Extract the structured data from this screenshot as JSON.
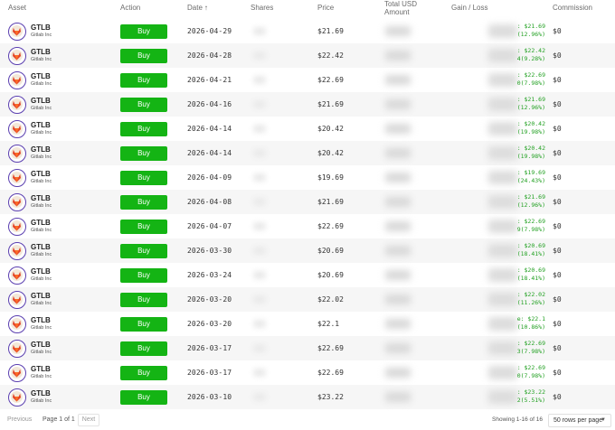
{
  "columns": {
    "asset": "Asset",
    "action": "Action",
    "date": "Date",
    "date_sort_icon": "arrow-up-icon",
    "shares": "Shares",
    "price": "Price",
    "total_usd_line1": "Total USD",
    "total_usd_line2": "Amount",
    "gain_loss": "Gain / Loss",
    "commission": "Commission"
  },
  "rows": [
    {
      "ticker": "GTLB",
      "company": "Gitlab Inc",
      "action": "Buy",
      "date": "2026-04-29",
      "price": "$21.69",
      "gain_line1": ": $21.69",
      "gain_line2": "(12.96%)",
      "commission": "$0"
    },
    {
      "ticker": "GTLB",
      "company": "Gitlab Inc",
      "action": "Buy",
      "date": "2026-04-28",
      "price": "$22.42",
      "gain_line1": ": $22.42",
      "gain_line2": "4(9.28%)",
      "commission": "$0"
    },
    {
      "ticker": "GTLB",
      "company": "Gitlab Inc",
      "action": "Buy",
      "date": "2026-04-21",
      "price": "$22.69",
      "gain_line1": ": $22.69",
      "gain_line2": "0(7.98%)",
      "commission": "$0"
    },
    {
      "ticker": "GTLB",
      "company": "Gitlab Inc",
      "action": "Buy",
      "date": "2026-04-16",
      "price": "$21.69",
      "gain_line1": ": $21.69",
      "gain_line2": "(12.96%)",
      "commission": "$0"
    },
    {
      "ticker": "GTLB",
      "company": "Gitlab Inc",
      "action": "Buy",
      "date": "2026-04-14",
      "price": "$20.42",
      "gain_line1": ": $20.42",
      "gain_line2": "(19.98%)",
      "commission": "$0"
    },
    {
      "ticker": "GTLB",
      "company": "Gitlab Inc",
      "action": "Buy",
      "date": "2026-04-14",
      "price": "$20.42",
      "gain_line1": ": $20.42",
      "gain_line2": "(19.98%)",
      "commission": "$0"
    },
    {
      "ticker": "GTLB",
      "company": "Gitlab Inc",
      "action": "Buy",
      "date": "2026-04-09",
      "price": "$19.69",
      "gain_line1": ": $19.69",
      "gain_line2": "(24.43%)",
      "commission": "$0"
    },
    {
      "ticker": "GTLB",
      "company": "Gitlab Inc",
      "action": "Buy",
      "date": "2026-04-08",
      "price": "$21.69",
      "gain_line1": ": $21.69",
      "gain_line2": "(12.96%)",
      "commission": "$0"
    },
    {
      "ticker": "GTLB",
      "company": "Gitlab Inc",
      "action": "Buy",
      "date": "2026-04-07",
      "price": "$22.69",
      "gain_line1": ": $22.69",
      "gain_line2": "9(7.98%)",
      "commission": "$0"
    },
    {
      "ticker": "GTLB",
      "company": "Gitlab Inc",
      "action": "Buy",
      "date": "2026-03-30",
      "price": "$20.69",
      "gain_line1": ": $20.69",
      "gain_line2": "(18.41%)",
      "commission": "$0"
    },
    {
      "ticker": "GTLB",
      "company": "Gitlab Inc",
      "action": "Buy",
      "date": "2026-03-24",
      "price": "$20.69",
      "gain_line1": ": $20.69",
      "gain_line2": "(18.41%)",
      "commission": "$0"
    },
    {
      "ticker": "GTLB",
      "company": "Gitlab Inc",
      "action": "Buy",
      "date": "2026-03-20",
      "price": "$22.02",
      "gain_line1": ": $22.02",
      "gain_line2": "(11.26%)",
      "commission": "$0"
    },
    {
      "ticker": "GTLB",
      "company": "Gitlab Inc",
      "action": "Buy",
      "date": "2026-03-20",
      "price": "$22.1",
      "gain_line1": "e: $22.1",
      "gain_line2": "(10.86%)",
      "commission": "$0"
    },
    {
      "ticker": "GTLB",
      "company": "Gitlab Inc",
      "action": "Buy",
      "date": "2026-03-17",
      "price": "$22.69",
      "gain_line1": ": $22.69",
      "gain_line2": "3(7.98%)",
      "commission": "$0"
    },
    {
      "ticker": "GTLB",
      "company": "Gitlab Inc",
      "action": "Buy",
      "date": "2026-03-17",
      "price": "$22.69",
      "gain_line1": ": $22.69",
      "gain_line2": "0(7.98%)",
      "commission": "$0"
    },
    {
      "ticker": "GTLB",
      "company": "Gitlab Inc",
      "action": "Buy",
      "date": "2026-03-10",
      "price": "$23.22",
      "gain_line1": ": $23.22",
      "gain_line2": "2(5.51%)",
      "commission": "$0"
    }
  ],
  "pagination": {
    "previous": "Previous",
    "page_info": "Page 1 of 1",
    "next": "Next",
    "showing": "Showing 1-16 of 16",
    "rows_per_page": "50 rows per page",
    "rows_per_page_icon": "chevron-down-icon"
  },
  "colors": {
    "buy_button": "#14b414",
    "gain_text": "#22a022",
    "row_alt": "#f6f6f6",
    "logo_ring": "#5b3fb0",
    "logo_fox": "#e2432a"
  }
}
